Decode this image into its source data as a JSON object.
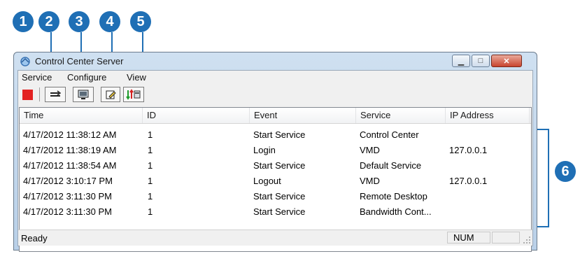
{
  "callouts": [
    "1",
    "2",
    "3",
    "4",
    "5",
    "6"
  ],
  "window": {
    "title": "Control Center Server",
    "minimize_glyph": "▁",
    "maximize_glyph": "□",
    "close_glyph": "✕"
  },
  "menu": [
    "Service",
    "Configure",
    "View"
  ],
  "toolbar": {
    "icons": [
      "stop-icon",
      "network-icon",
      "monitor-icon",
      "edit-icon",
      "transfer-icon"
    ]
  },
  "table": {
    "columns": [
      "Time",
      "ID",
      "Event",
      "Service",
      "IP Address"
    ],
    "rows": [
      [
        "4/17/2012 11:38:12 AM",
        "1",
        "Start Service",
        "Control Center",
        ""
      ],
      [
        "4/17/2012 11:38:19 AM",
        "1",
        "Login",
        "VMD",
        "127.0.0.1"
      ],
      [
        "4/17/2012 11:38:54 AM",
        "1",
        "Start Service",
        "Default Service",
        ""
      ],
      [
        "4/17/2012 3:10:17 PM",
        "1",
        "Logout",
        "VMD",
        "127.0.0.1"
      ],
      [
        "4/17/2012 3:11:30 PM",
        "1",
        "Start Service",
        "Remote Desktop",
        ""
      ],
      [
        "4/17/2012 3:11:30 PM",
        "1",
        "Start Service",
        "Bandwidth Cont...",
        ""
      ]
    ]
  },
  "status": {
    "left": "Ready",
    "num": "NUM"
  },
  "colors": {
    "callout": "#1f6fb5",
    "stop": "#e32222"
  }
}
